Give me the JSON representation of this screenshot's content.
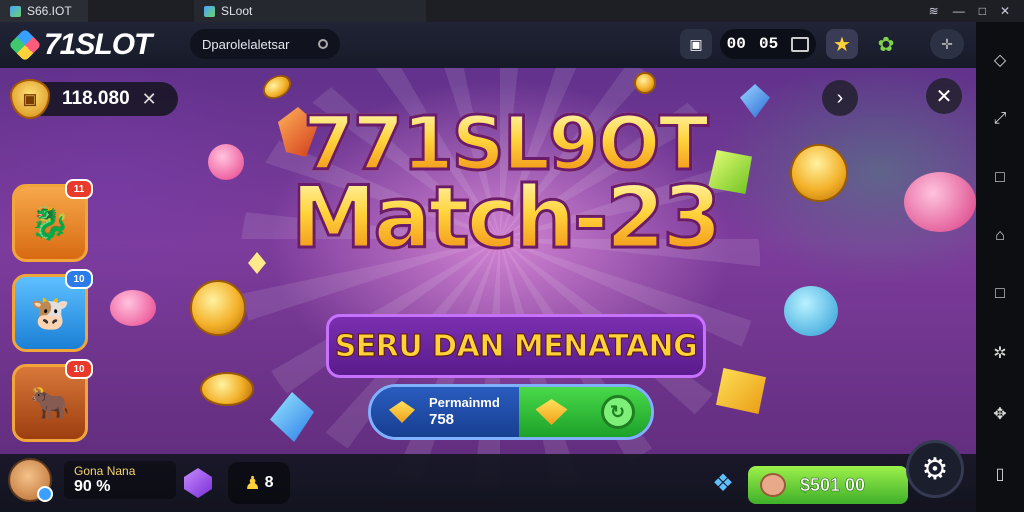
{
  "window": {
    "tabs": [
      {
        "label": "S66.IOT"
      },
      {
        "label": "SLoot"
      }
    ],
    "controls": {
      "wifi": "wifi-icon",
      "minimize": "—",
      "maximize": "□",
      "close": "✕"
    }
  },
  "emulator_sidebar": {
    "icons": [
      "diamond-icon",
      "expand-icon",
      "square-icon",
      "home-icon",
      "square-icon",
      "settings-icon",
      "puzzle-icon",
      "device-icon"
    ]
  },
  "header": {
    "logo_text": "71SLOT",
    "search_text": "Dparolelaletsar",
    "timer": {
      "h": "00",
      "m": "05"
    }
  },
  "balance": {
    "value": "118.080",
    "close": "✕"
  },
  "title": {
    "line1": "771SL9OT",
    "line2": "Match-23",
    "subtitle": "SERU DAN MENATANG"
  },
  "playbar": {
    "label": "Permainmd",
    "count": "758"
  },
  "left_cards": [
    {
      "badge": "11",
      "badge_color": "#e8392b",
      "face_color": "#f08a1a"
    },
    {
      "badge": "10",
      "badge_color": "#2b7be8",
      "face_color": "#2b9bf0"
    },
    {
      "badge": "10",
      "badge_color": "#e8392b",
      "face_color": "#c65a1a"
    }
  ],
  "player": {
    "name": "Gona Nana",
    "score": "90 %"
  },
  "bottom": {
    "bag_label": "8",
    "cash": "$501 00"
  },
  "colors": {
    "accent_gold": "#ffd23a",
    "play_green": "#49d94a",
    "play_blue": "#1d3f8a",
    "purple_bg": "#7d3c9c"
  }
}
